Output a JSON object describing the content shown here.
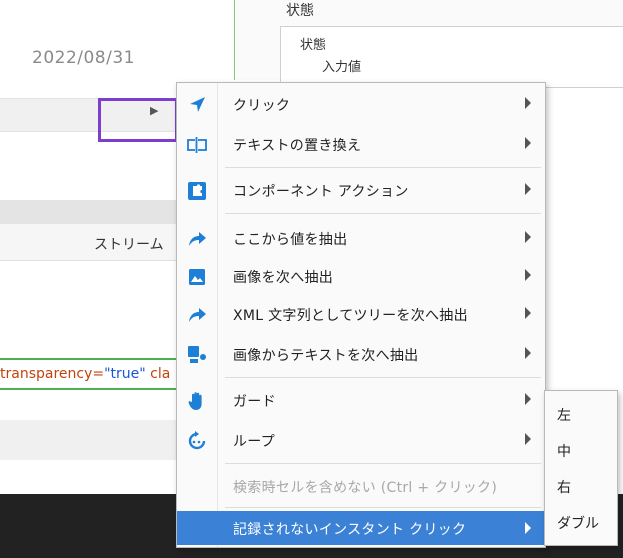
{
  "background": {
    "date": "2022/08/31",
    "stream_label": "ストリーム",
    "code": {
      "attr": "transparency=",
      "value": "\"true\"",
      "tail": " cla"
    },
    "state_header": "状態",
    "tree": {
      "node": "状態",
      "child": "入力値"
    }
  },
  "menu": {
    "items": [
      {
        "label": "クリック",
        "icon": "cursor-arrow-icon"
      },
      {
        "label": "テキストの置き換え",
        "icon": "text-cursor-icon"
      },
      {
        "label": "コンポーネント アクション",
        "icon": "puzzle-icon"
      },
      {
        "label": "ここから値を抽出",
        "icon": "share-arrow-icon"
      },
      {
        "label": "画像を次へ抽出",
        "icon": "image-icon"
      },
      {
        "label": "XML 文字列としてツリーを次へ抽出",
        "icon": "share-arrow-icon"
      },
      {
        "label": "画像からテキストを次へ抽出",
        "icon": "image-text-icon"
      },
      {
        "label": "ガード",
        "icon": "hand-icon"
      },
      {
        "label": "ループ",
        "icon": "loop-icon"
      },
      {
        "label": "検索時セルを含めない (Ctrl + クリック)"
      },
      {
        "label": "記録されないインスタント クリック"
      }
    ]
  },
  "submenu": {
    "items": [
      "左",
      "中",
      "右",
      "ダブル"
    ]
  },
  "colors": {
    "accent": "#3b82d6",
    "highlight_box": "#7a3fcf",
    "icon_blue": "#1e7fd6",
    "code_border": "#4caf50"
  }
}
